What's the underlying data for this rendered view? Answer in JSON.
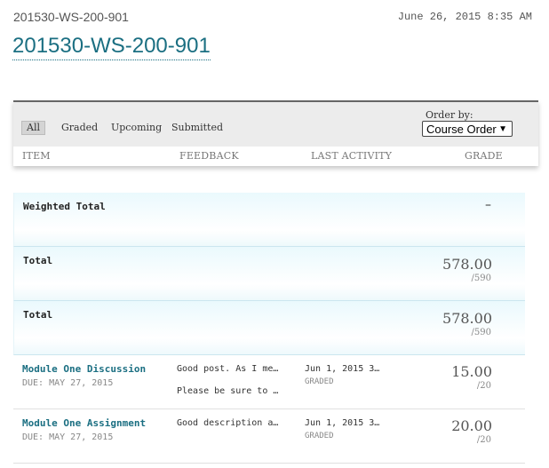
{
  "header": {
    "course_code": "201530-WS-200-901",
    "datetime": "June 26, 2015 8:35 AM",
    "title": "201530-WS-200-901"
  },
  "filters": {
    "tabs": [
      "All",
      "Graded",
      "Upcoming",
      "Submitted"
    ],
    "active": "All",
    "order_label": "Order by:",
    "order_value": "Course Order"
  },
  "columns": {
    "item": "ITEM",
    "feedback": "FEEDBACK",
    "last_activity": "LAST ACTIVITY",
    "grade": "GRADE"
  },
  "totals": [
    {
      "label": "Weighted Total",
      "value": "–",
      "max": ""
    },
    {
      "label": "Total",
      "value": "578.00",
      "max": "/590"
    },
    {
      "label": "Total",
      "value": "578.00",
      "max": "/590"
    }
  ],
  "items": [
    {
      "name": "Module One Discussion",
      "due": "DUE: MAY 27, 2015",
      "feedback": [
        "Good post. As I me…",
        "Please be sure to …"
      ],
      "activity": "Jun 1, 2015 3…",
      "status": "GRADED",
      "grade": "15.00",
      "max": "/20"
    },
    {
      "name": "Module One Assignment",
      "due": "DUE: MAY 27, 2015",
      "feedback": [
        "Good description a…"
      ],
      "activity": "Jun 1, 2015 3…",
      "status": "GRADED",
      "grade": "20.00",
      "max": "/20"
    }
  ]
}
